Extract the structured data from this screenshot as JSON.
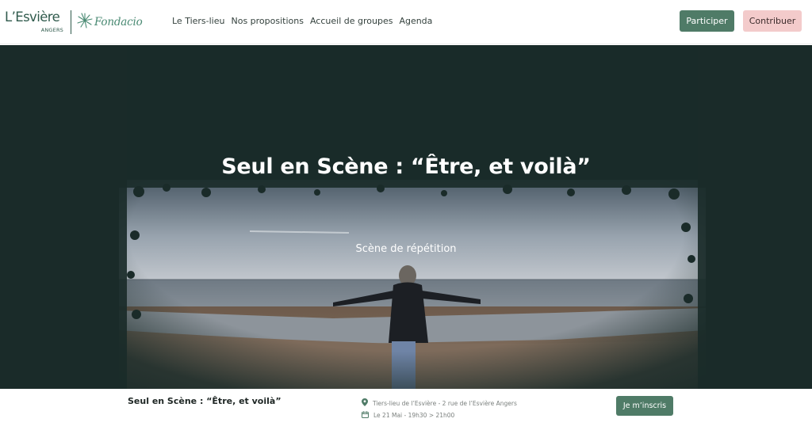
{
  "header": {
    "logo": {
      "name": "L’Esvière",
      "city": "ANGERS",
      "partner": "Fondacio"
    },
    "nav": [
      {
        "label": "Le Tiers-lieu"
      },
      {
        "label": "Nos propositions"
      },
      {
        "label": "Accueil de groupes"
      },
      {
        "label": "Agenda"
      }
    ],
    "participer_label": "Participer",
    "contribuer_label": "Contribuer"
  },
  "hero": {
    "title": "Seul en Scène : “Être, et voilà”",
    "subtitle": "Scène de répétition"
  },
  "event_bar": {
    "title": "Seul en Scène : “Être, et voilà”",
    "location": "Tiers-lieu de l’Esvière - 2 rue de l’Esvière Angers",
    "date": "Le 21 Mai - 19h30 > 21h00",
    "register_label": "Je m’inscris"
  },
  "colors": {
    "brand_green": "#4f7b67",
    "brand_pink": "#f3cbcb",
    "hero_dark": "#1a2b29"
  },
  "icons": [
    "location-pin-icon",
    "calendar-icon",
    "fondacio-sun-icon"
  ]
}
